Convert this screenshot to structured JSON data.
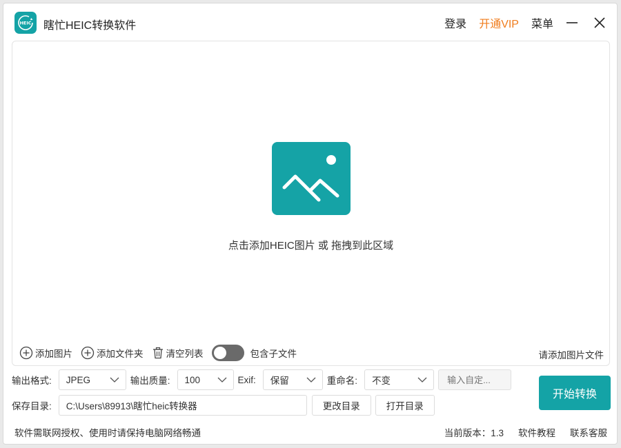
{
  "app": {
    "title": "瞎忙HEIC转换软件",
    "logo_text": "HEIC",
    "accent": "#14a3a6",
    "vip_color": "#f07c1c"
  },
  "titlebar": {
    "login": "登录",
    "vip": "开通VIP",
    "menu": "菜单",
    "minimize_icon": "minimize-icon",
    "close_icon": "close-icon"
  },
  "drop": {
    "icon": "image-icon",
    "hint": "点击添加HEIC图片 或 拖拽到此区域",
    "add_image": "添加图片",
    "add_folder": "添加文件夹",
    "clear_list": "清空列表",
    "include_sub": "包含子文件",
    "include_sub_enabled": false,
    "status": "请添加图片文件"
  },
  "settings": {
    "format_label": "输出格式:",
    "format_value": "JPEG",
    "quality_label": "输出质量:",
    "quality_value": "100",
    "exif_label": "Exif:",
    "exif_value": "保留",
    "rename_label": "重命名:",
    "rename_value": "不变",
    "custom_placeholder": "输入自定...",
    "save_label": "保存目录:",
    "save_path": "C:\\Users\\89913\\瞎忙heic转换器",
    "change_dir": "更改目录",
    "open_dir": "打开目录",
    "start": "开始转换"
  },
  "footer": {
    "notice": "软件需联网授权、使用时请保持电脑网络畅通",
    "version": "当前版本：1.3",
    "tutorial": "软件教程",
    "support": "联系客服"
  }
}
